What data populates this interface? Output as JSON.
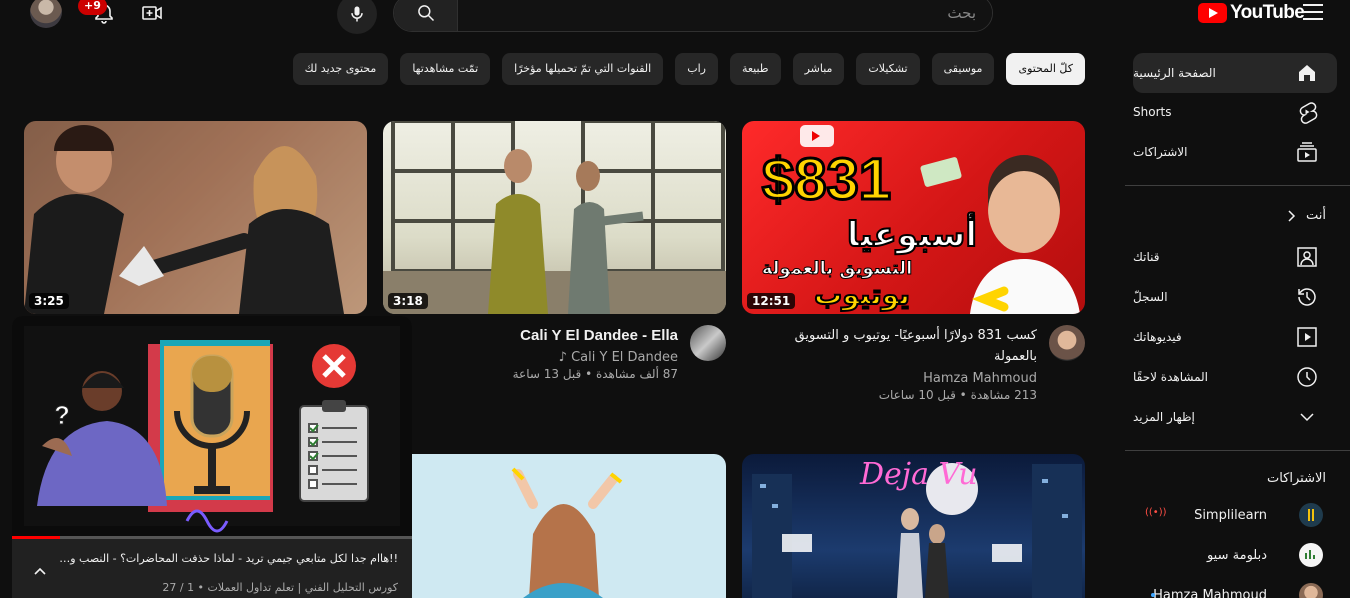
{
  "header": {
    "logo_text": "YouTube",
    "search_placeholder": "بحث",
    "notification_count": "+9"
  },
  "chips": [
    {
      "label": "كلّ المحتوى",
      "active": true
    },
    {
      "label": "موسيقى"
    },
    {
      "label": "تشكيلات"
    },
    {
      "label": "مباشر"
    },
    {
      "label": "طبيعة"
    },
    {
      "label": "راب"
    },
    {
      "label": "القنوات التي تمّ تحميلها مؤخرًا"
    },
    {
      "label": "تمّت مشاهدتها"
    },
    {
      "label": "محتوى جديد لك"
    }
  ],
  "sidebar": {
    "main": [
      {
        "label": "الصفحة الرئيسية",
        "icon": "home-icon"
      },
      {
        "label": "Shorts",
        "icon": "shorts-icon"
      },
      {
        "label": "الاشتراكات",
        "icon": "subscriptions-icon"
      }
    ],
    "you": {
      "heading": "أنت",
      "items": [
        {
          "label": "قناتك",
          "icon": "your-channel-icon"
        },
        {
          "label": "السجلّ",
          "icon": "history-icon"
        },
        {
          "label": "فيديوهاتك",
          "icon": "your-videos-icon"
        },
        {
          "label": "المشاهدة لاحقًا",
          "icon": "watch-later-icon"
        },
        {
          "label": "إظهار المزيد",
          "icon": "chevron-down-icon"
        }
      ]
    },
    "subscriptions": {
      "heading": "الاشتراكات",
      "items": [
        {
          "label": "Simplilearn",
          "live": true
        },
        {
          "label": "دبلومة سيو"
        },
        {
          "label": "Hamza Mahmoud",
          "new": true
        }
      ]
    }
  },
  "videos": [
    {
      "title": "كسب 831 دولارًا أسبوعيًا- يوتيوب و التسويق بالعمولة",
      "channel": "Hamza Mahmoud",
      "meta": "213 مشاهدة • قبل 10 ساعات",
      "duration": "12:51",
      "thumb_text_1": "$831",
      "thumb_text_2": "أسبوعيا",
      "thumb_text_3": "التسويق بالعمولة",
      "thumb_text_4": "يوتيوب"
    },
    {
      "title": "Cali Y El Dandee - Ella",
      "channel": "Cali Y El Dandee",
      "meta": "87 ألف مشاهدة • قبل 13 ساعة",
      "duration": "3:18"
    },
    {
      "duration": "3:25"
    }
  ],
  "miniplayer": {
    "title": "!!هاام جدا لكل متابعي جيمي تريد - لماذا حذفت المحاضرات؟ - النصب وا...",
    "subtitle": "كورس التحليل الفني | تعلم تداول العملات • 1 / 27",
    "progress": 0.12
  }
}
